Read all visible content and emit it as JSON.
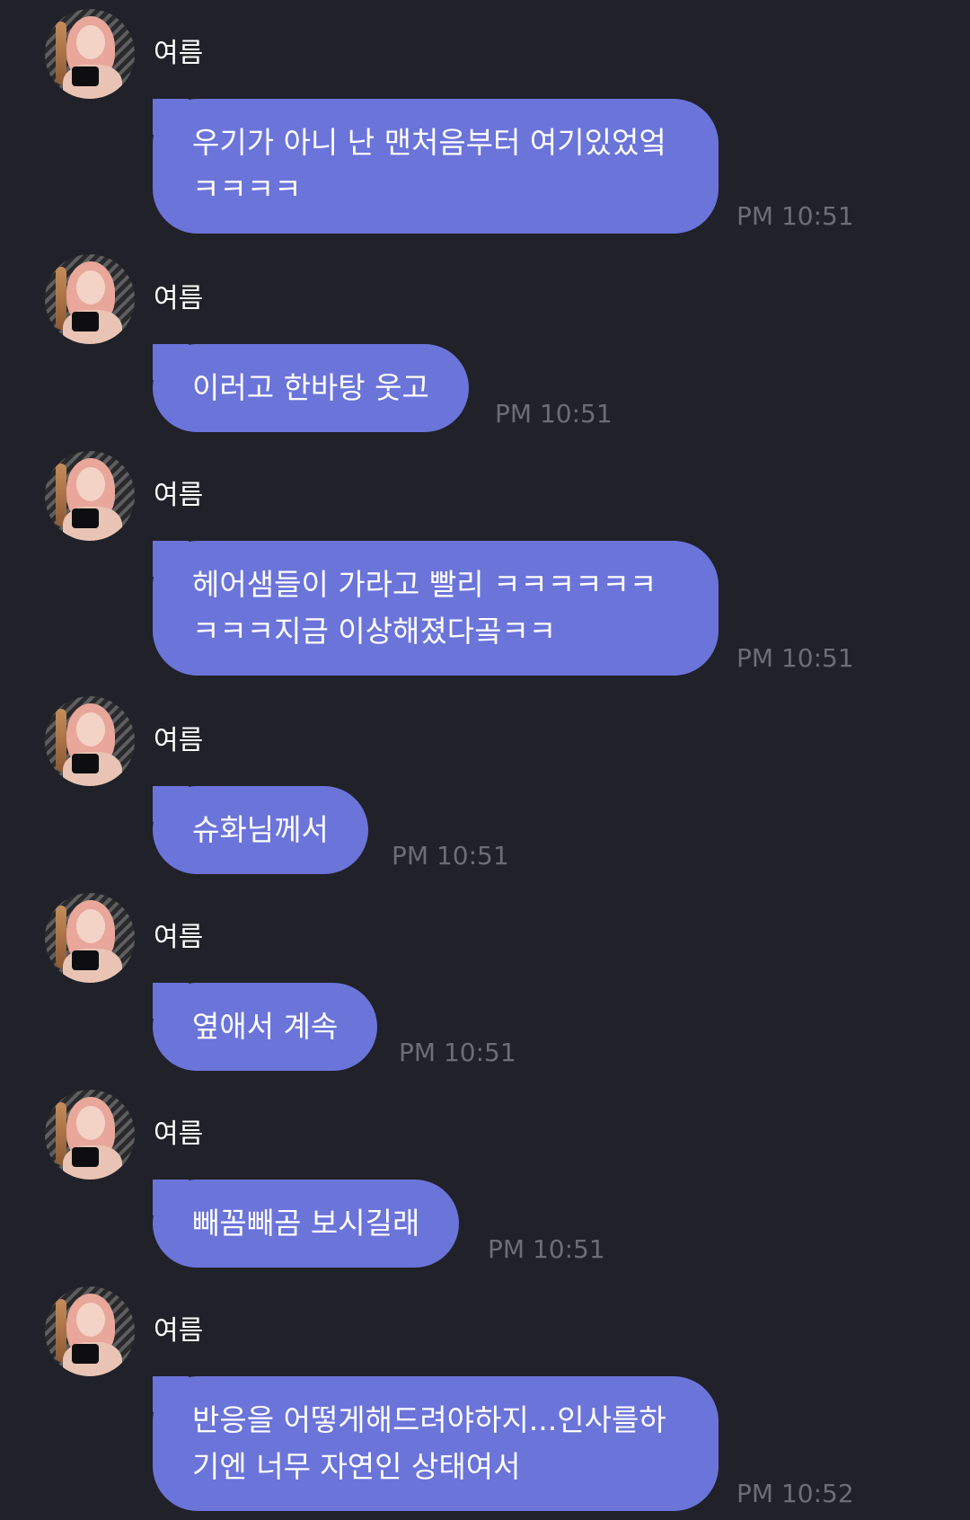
{
  "conversation": {
    "messages": [
      {
        "sender": "여름",
        "text": "우기가 아니 난 맨처음부터 여기있었엌ㅋㅋㅋㅋ",
        "time": "PM 10:51"
      },
      {
        "sender": "여름",
        "text": "이러고 한바탕 웃고",
        "time": "PM 10:51"
      },
      {
        "sender": "여름",
        "text": "헤어샘들이 가라고 빨리 ㅋㅋㅋㅋㅋㅋㅋㅋㅋ지금 이상해졌다곸ㅋㅋ",
        "time": "PM 10:51"
      },
      {
        "sender": "여름",
        "text": "슈화님께서",
        "time": "PM 10:51"
      },
      {
        "sender": "여름",
        "text": "옆애서 계속",
        "time": "PM 10:51"
      },
      {
        "sender": "여름",
        "text": "빼꼼빼곰 보시길래",
        "time": "PM 10:51"
      },
      {
        "sender": "여름",
        "text": "반응을 어떻게해드려야하지...인사를하기엔 너무 자연인 상태여서",
        "time": "PM 10:52"
      }
    ]
  },
  "colors": {
    "background": "#212129",
    "bubble": "#6b74d9",
    "text": "#ffffff",
    "timestamp": "#6d6d75"
  },
  "icons": {
    "avatar": "profile-photo-avatar"
  }
}
